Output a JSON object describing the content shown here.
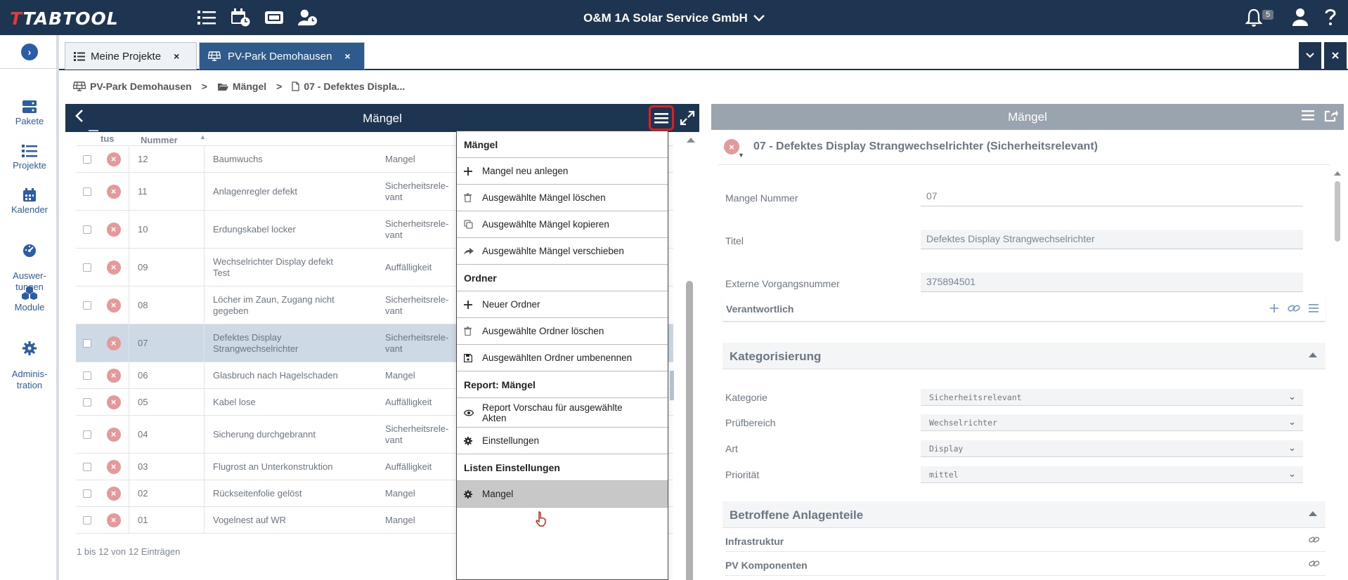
{
  "topbar": {
    "logo": "TABTOOL",
    "company": "O&M 1A Solar Service GmbH",
    "notifications_count": "5",
    "icons": [
      "list-icon",
      "calendar-clock-icon",
      "dashboard-icon",
      "user-clock-icon",
      "bell-icon",
      "user-icon",
      "help-icon"
    ]
  },
  "rail": {
    "items": [
      {
        "label": "Pakete",
        "icon": "server-icon"
      },
      {
        "label": "Projekte",
        "icon": "list-icon"
      },
      {
        "label": "Kalender",
        "icon": "calendar-icon"
      },
      {
        "label": "Auswer-\ntungen",
        "icon": "gauge-icon"
      },
      {
        "label": "Module",
        "icon": "cubes-icon"
      },
      {
        "label": "Adminis-\ntration",
        "icon": "gear-icon"
      }
    ]
  },
  "tabs": [
    {
      "label": "Meine Projekte",
      "close": "×"
    },
    {
      "label": "PV-Park Demohausen",
      "close": "×"
    }
  ],
  "breadcrumb": {
    "items": [
      "PV-Park Demohausen",
      "Mängel",
      "07 - Defektes Displa..."
    ],
    "sep": ">"
  },
  "left_panel": {
    "title": "Mängel",
    "columns": {
      "status": "tus",
      "number": "Nummer"
    },
    "rows": [
      {
        "nr": "12",
        "title": "Baumwuchs",
        "kategorie": "Mangel"
      },
      {
        "nr": "11",
        "title": "Anlagenregler defekt",
        "kategorie": "Sicherheitsrele-\nvant"
      },
      {
        "nr": "10",
        "title": "Erdungskabel locker",
        "kategorie": "Sicherheitsrele-\nvant"
      },
      {
        "nr": "09",
        "title": "Wechselrichter Display defekt\nTest",
        "kategorie": "Auffälligkeit"
      },
      {
        "nr": "08",
        "title": "Löcher im Zaun, Zugang nicht\ngegeben",
        "kategorie": "Sicherheitsrele-\nvant"
      },
      {
        "nr": "07",
        "title": "Defektes Display\nStrangwechselrichter",
        "kategorie": "Sicherheitsrele-\nvant"
      },
      {
        "nr": "06",
        "title": "Glasbruch nach Hagelschaden",
        "kategorie": "Mangel"
      },
      {
        "nr": "05",
        "title": "Kabel lose",
        "kategorie": "Auffälligkeit"
      },
      {
        "nr": "04",
        "title": "Sicherung durchgebrannt",
        "kategorie": "Sicherheitsrele-\nvant"
      },
      {
        "nr": "03",
        "title": "Flugrost an Unterkonstruktion",
        "kategorie": "Auffälligkeit"
      },
      {
        "nr": "02",
        "title": "Rückseitenfolie gelöst",
        "kategorie": "Mangel"
      },
      {
        "nr": "01",
        "title": "Vogelnest auf WR",
        "kategorie": "Mangel"
      }
    ],
    "footer": "1 bis 12 von 12 Einträgen"
  },
  "dropdown": {
    "sections": [
      {
        "header": "Mängel",
        "items": [
          {
            "label": "Mangel neu anlegen",
            "icon": "plus-icon"
          },
          {
            "label": "Ausgewählte Mängel löschen",
            "icon": "trash-icon"
          },
          {
            "label": "Ausgewählte Mängel kopieren",
            "icon": "copy-icon"
          },
          {
            "label": "Ausgewählte Mängel verschieben",
            "icon": "share-icon"
          }
        ]
      },
      {
        "header": "Ordner",
        "items": [
          {
            "label": "Neuer Ordner",
            "icon": "plus-icon"
          },
          {
            "label": "Ausgewählte Ordner löschen",
            "icon": "trash-icon"
          },
          {
            "label": "Ausgewählten Ordner umbenennen",
            "icon": "save-icon"
          }
        ]
      },
      {
        "header": "Report: Mängel",
        "items": [
          {
            "label": "Report Vorschau für ausgewählte\nAkten",
            "icon": "eye-icon"
          },
          {
            "label": "Einstellungen",
            "icon": "gear-icon"
          }
        ]
      },
      {
        "header": "Listen Einstellungen",
        "items": [
          {
            "label": "Mangel",
            "icon": "gear-icon"
          }
        ]
      }
    ]
  },
  "right_panel": {
    "title": "Mängel",
    "record_title": "07 - Defektes Display Strangwechselrichter (Sicherheitsrelevant)",
    "fields": {
      "nummer_label": "Mangel Nummer",
      "nummer_value": "07",
      "titel_label": "Titel",
      "titel_value": "Defektes Display Strangwechselrichter",
      "extern_label": "Externe Vorgangsnummer",
      "extern_value": "375894501"
    },
    "verantwortlich": "Verantwortlich",
    "kategorisierung": {
      "header": "Kategorisierung",
      "kategorie_label": "Kategorie",
      "kategorie_value": "Sicherheitsrelevant",
      "pruefbereich_label": "Prüfbereich",
      "pruefbereich_value": "Wechselrichter",
      "art_label": "Art",
      "art_value": "Display",
      "prioritaet_label": "Priorität",
      "prioritaet_value": "mittel"
    },
    "anlagenteile": {
      "header": "Betroffene Anlagenteile",
      "infrastruktur": "Infrastruktur",
      "pv_komponenten": "PV Komponenten"
    }
  },
  "colors": {
    "navy": "#1d3550",
    "tab_active": "#2f5b8c",
    "highlight_red": "#e0201f",
    "status_red": "#e49a9a",
    "link_blue": "#2a5da8"
  }
}
